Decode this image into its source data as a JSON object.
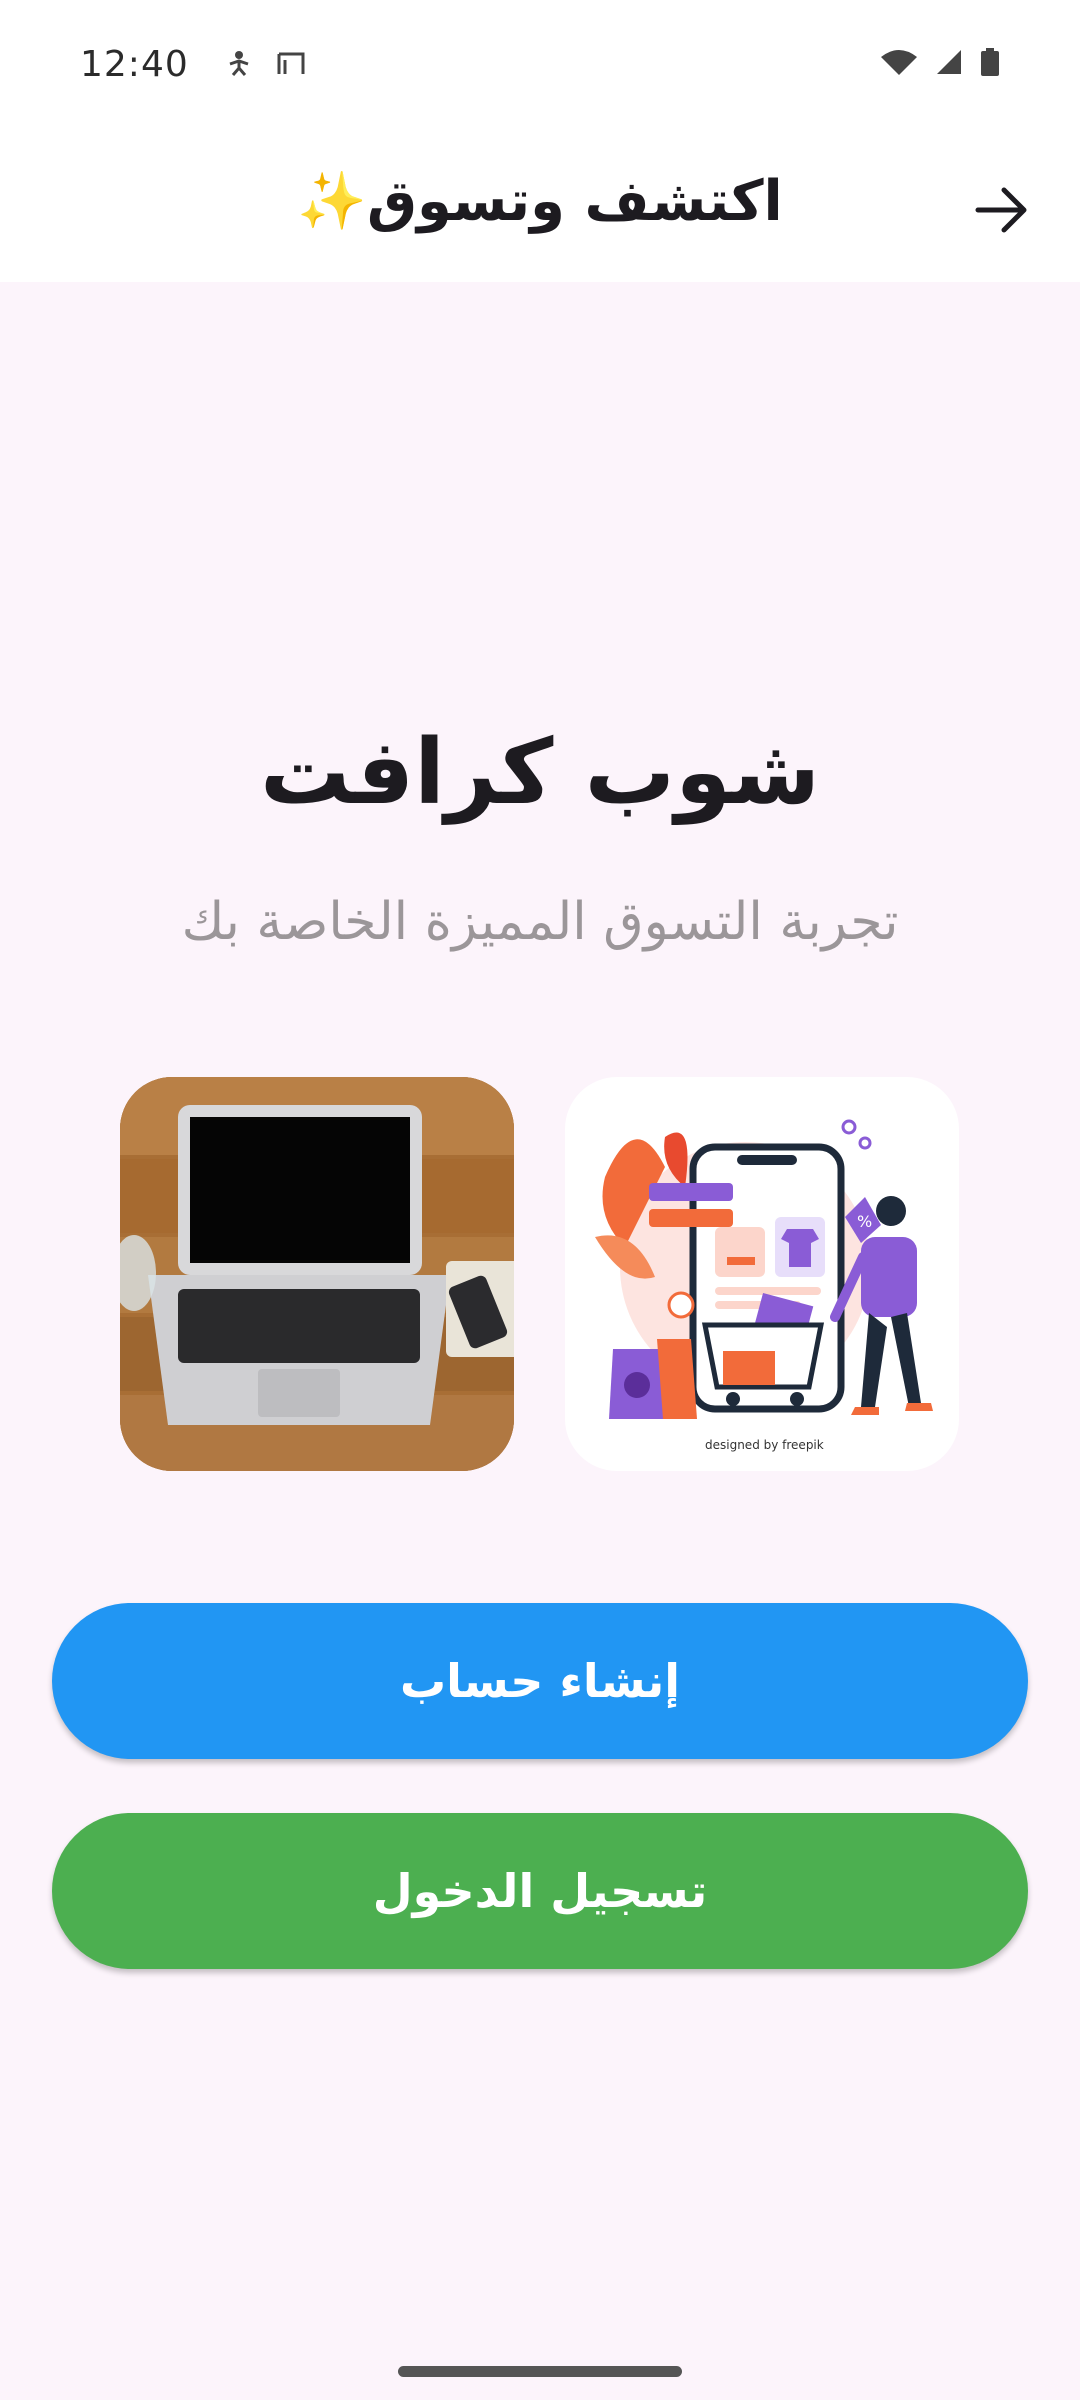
{
  "status_bar": {
    "time": "12:40",
    "left_icons": [
      "accessibility-icon",
      "screen-record-icon"
    ],
    "right_icons": [
      "wifi-icon",
      "signal-icon",
      "battery-icon"
    ]
  },
  "app_bar": {
    "title": "اكتشف وتسوق✨",
    "back_icon": "arrow-forward-icon"
  },
  "hero": {
    "title": "شوب كرافت",
    "subtitle": "تجربة التسوق المميزة الخاصة بك"
  },
  "images": {
    "shop_caption": "designed by freepik"
  },
  "buttons": {
    "create_account": "إنشاء حساب",
    "login": "تسجيل الدخول"
  },
  "colors": {
    "background": "#fcf4fb",
    "create_account_button": "#2196f3",
    "login_button": "#4caf50",
    "subtitle": "#9b9699"
  }
}
